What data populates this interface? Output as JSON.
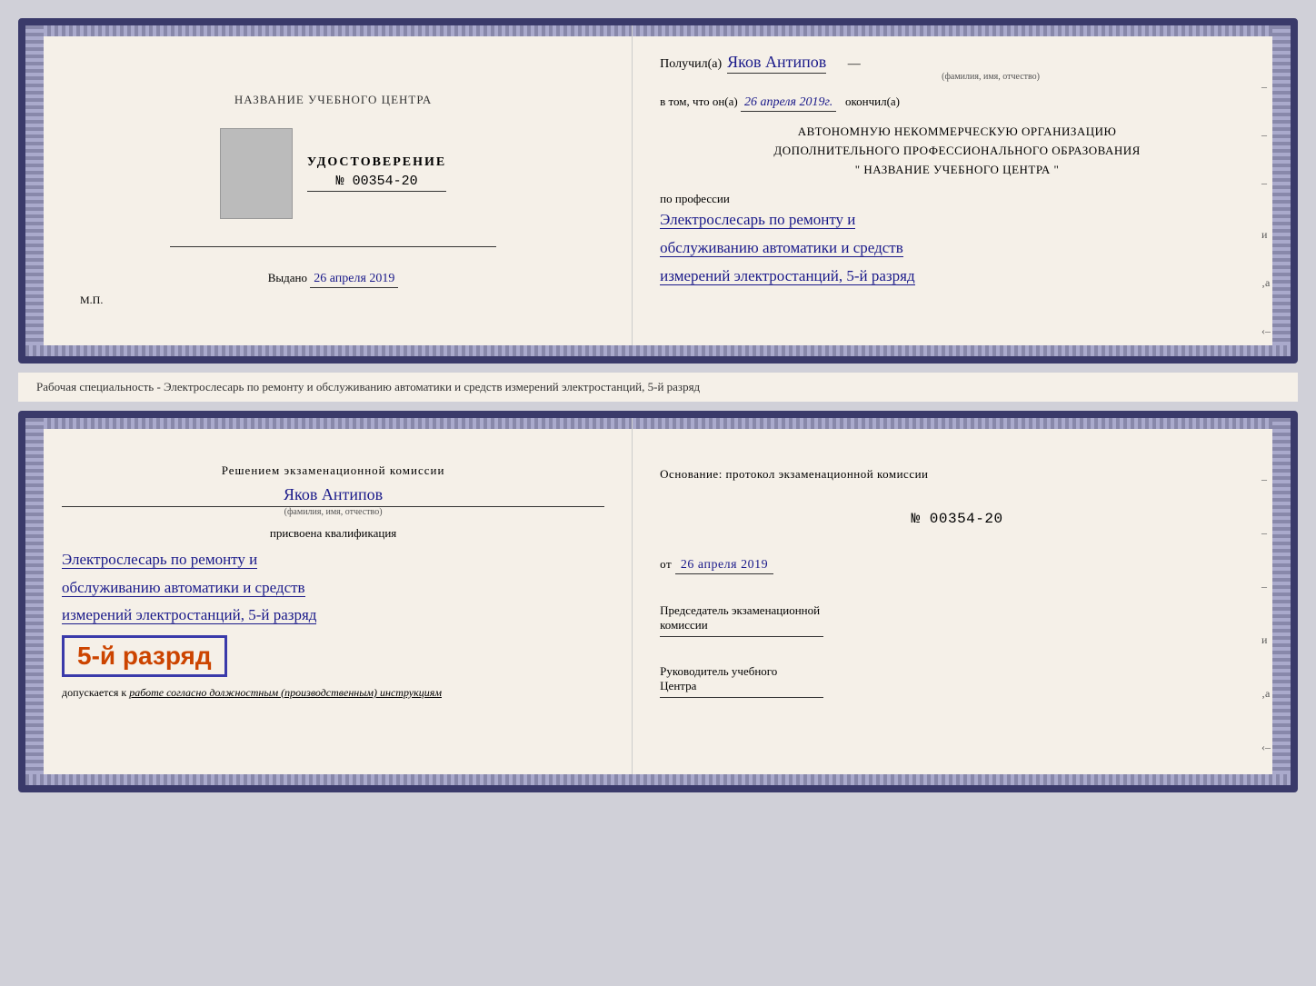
{
  "top_cert": {
    "left": {
      "org_name": "НАЗВАНИЕ УЧЕБНОГО ЦЕНТРА",
      "udostoverenie_title": "УДОСТОВЕРЕНИЕ",
      "number": "№ 00354-20",
      "vydano_label": "Выдано",
      "vydano_date": "26 апреля 2019",
      "mp_label": "М.П."
    },
    "right": {
      "poluchil_label": "Получил(а)",
      "recipient_name": "Яков Антипов",
      "fio_sublabel": "(фамилия, имя, отчество)",
      "vtom_label": "в том, что он(а)",
      "completion_date": "26 апреля 2019г.",
      "okonchil_label": "окончил(а)",
      "org_line1": "АВТОНОМНУЮ НЕКОММЕРЧЕСКУЮ ОРГАНИЗАЦИЮ",
      "org_line2": "ДОПОЛНИТЕЛЬНОГО ПРОФЕССИОНАЛЬНОГО ОБРАЗОВАНИЯ",
      "org_quote": "\"",
      "org_name_center": "НАЗВАНИЕ УЧЕБНОГО ЦЕНТРА",
      "org_quote2": "\"",
      "po_professii_label": "по профессии",
      "profession_line1": "Электрослесарь по ремонту и",
      "profession_line2": "обслуживанию автоматики и средств",
      "profession_line3": "измерений электростанций, 5-й разряд"
    }
  },
  "info_text": "Рабочая специальность - Электрослесарь по ремонту и обслуживанию автоматики и средств измерений электростанций, 5-й разряд",
  "bottom_cert": {
    "left": {
      "resheniem_label": "Решением экзаменационной комиссии",
      "name": "Яков Антипов",
      "fio_sublabel": "(фамилия, имя, отчество)",
      "prisvoena_label": "присвоена квалификация",
      "qual_line1": "Электрослесарь по ремонту и",
      "qual_line2": "обслуживанию автоматики и средств",
      "qual_line3": "измерений электростанций, 5-й разряд",
      "razryad_badge": "5-й разряд",
      "dopuskaetsya_prefix": "допускается к",
      "dopuskaetsya_text": "работе согласно должностным (производственным) инструкциям"
    },
    "right": {
      "osnovanie_label": "Основание: протокол экзаменационной комиссии",
      "number": "№ 00354-20",
      "ot_label": "от",
      "date": "26 апреля 2019",
      "predsedatel_line1": "Председатель экзаменационной",
      "predsedatel_line2": "комиссии",
      "rukovoditel_line1": "Руководитель учебного",
      "rukovoditel_line2": "Центра"
    }
  }
}
